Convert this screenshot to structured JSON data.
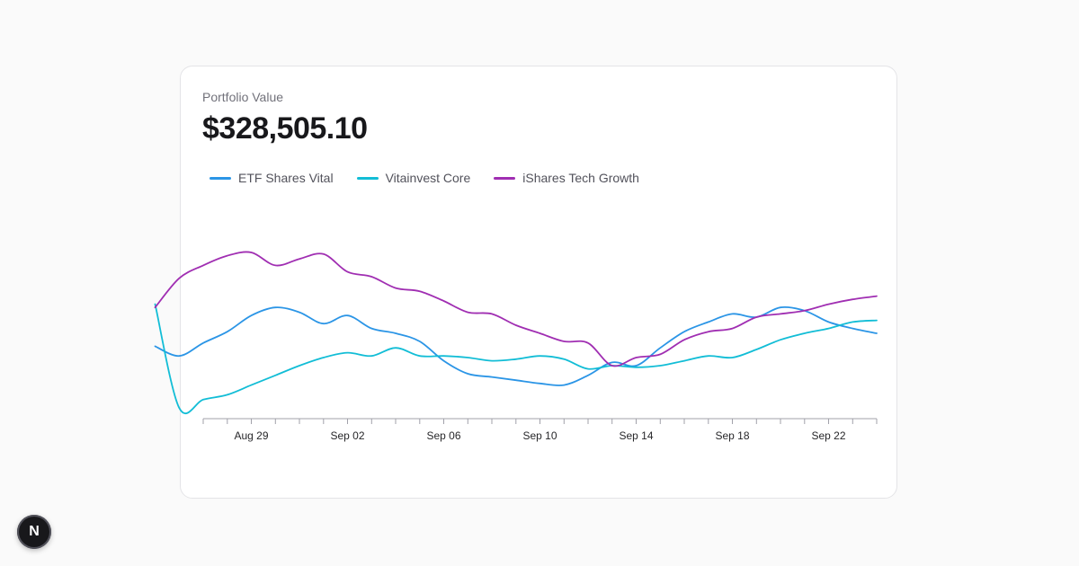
{
  "card": {
    "label": "Portfolio Value",
    "value": "$328,505.10"
  },
  "fab": {
    "letter": "N"
  },
  "colors": {
    "etf": "#2b95e6",
    "vita": "#12bdd6",
    "tech": "#a02eb2",
    "axis": "#a1a1aa"
  },
  "chart_data": {
    "type": "line",
    "x_start": "Aug 27",
    "x_end": "Sep 24",
    "x_ticks": [
      "Aug 29",
      "Sep 02",
      "Sep 06",
      "Sep 10",
      "Sep 14",
      "Sep 18",
      "Sep 22"
    ],
    "ylim": [
      0,
      1
    ],
    "grid": false,
    "legend_position": "top-left",
    "series": [
      {
        "name": "ETF Shares Vital",
        "color": "#2b95e6",
        "x": [
          "Aug 25",
          "Aug 26",
          "Aug 27",
          "Aug 28",
          "Aug 29",
          "Aug 30",
          "Aug 31",
          "Sep 01",
          "Sep 02",
          "Sep 03",
          "Sep 04",
          "Sep 05",
          "Sep 06",
          "Sep 07",
          "Sep 08",
          "Sep 09",
          "Sep 10",
          "Sep 11",
          "Sep 12",
          "Sep 13",
          "Sep 14",
          "Sep 15",
          "Sep 16",
          "Sep 17",
          "Sep 18",
          "Sep 19",
          "Sep 20",
          "Sep 21",
          "Sep 22",
          "Sep 23",
          "Sep 24"
        ],
        "values": [
          0.42,
          0.36,
          0.44,
          0.51,
          0.61,
          0.66,
          0.63,
          0.56,
          0.61,
          0.53,
          0.5,
          0.45,
          0.33,
          0.25,
          0.23,
          0.21,
          0.19,
          0.18,
          0.24,
          0.32,
          0.3,
          0.41,
          0.51,
          0.57,
          0.62,
          0.6,
          0.66,
          0.64,
          0.57,
          0.53,
          0.5
        ]
      },
      {
        "name": "Vitainvest Core",
        "color": "#12bdd6",
        "x": [
          "Aug 25",
          "Aug 26",
          "Aug 27",
          "Aug 28",
          "Aug 29",
          "Aug 30",
          "Aug 31",
          "Sep 01",
          "Sep 02",
          "Sep 03",
          "Sep 04",
          "Sep 05",
          "Sep 06",
          "Sep 07",
          "Sep 08",
          "Sep 09",
          "Sep 10",
          "Sep 11",
          "Sep 12",
          "Sep 13",
          "Sep 14",
          "Sep 15",
          "Sep 16",
          "Sep 17",
          "Sep 18",
          "Sep 19",
          "Sep 20",
          "Sep 21",
          "Sep 22",
          "Sep 23",
          "Sep 24"
        ],
        "values": [
          0.68,
          0.04,
          0.09,
          0.12,
          0.18,
          0.24,
          0.3,
          0.35,
          0.38,
          0.36,
          0.41,
          0.36,
          0.36,
          0.35,
          0.33,
          0.34,
          0.36,
          0.34,
          0.28,
          0.3,
          0.29,
          0.3,
          0.33,
          0.36,
          0.35,
          0.4,
          0.46,
          0.5,
          0.53,
          0.57,
          0.58
        ]
      },
      {
        "name": "iShares Tech Growth",
        "color": "#a02eb2",
        "x": [
          "Aug 25",
          "Aug 26",
          "Aug 27",
          "Aug 28",
          "Aug 29",
          "Aug 30",
          "Aug 31",
          "Sep 01",
          "Sep 02",
          "Sep 03",
          "Sep 04",
          "Sep 05",
          "Sep 06",
          "Sep 07",
          "Sep 08",
          "Sep 09",
          "Sep 10",
          "Sep 11",
          "Sep 12",
          "Sep 13",
          "Sep 14",
          "Sep 15",
          "Sep 16",
          "Sep 17",
          "Sep 18",
          "Sep 19",
          "Sep 20",
          "Sep 21",
          "Sep 22",
          "Sep 23",
          "Sep 24"
        ],
        "values": [
          0.66,
          0.84,
          0.92,
          0.98,
          1.0,
          0.92,
          0.96,
          0.99,
          0.88,
          0.85,
          0.78,
          0.76,
          0.7,
          0.63,
          0.62,
          0.55,
          0.5,
          0.45,
          0.44,
          0.3,
          0.35,
          0.37,
          0.46,
          0.51,
          0.53,
          0.6,
          0.62,
          0.64,
          0.68,
          0.71,
          0.73
        ]
      }
    ]
  }
}
